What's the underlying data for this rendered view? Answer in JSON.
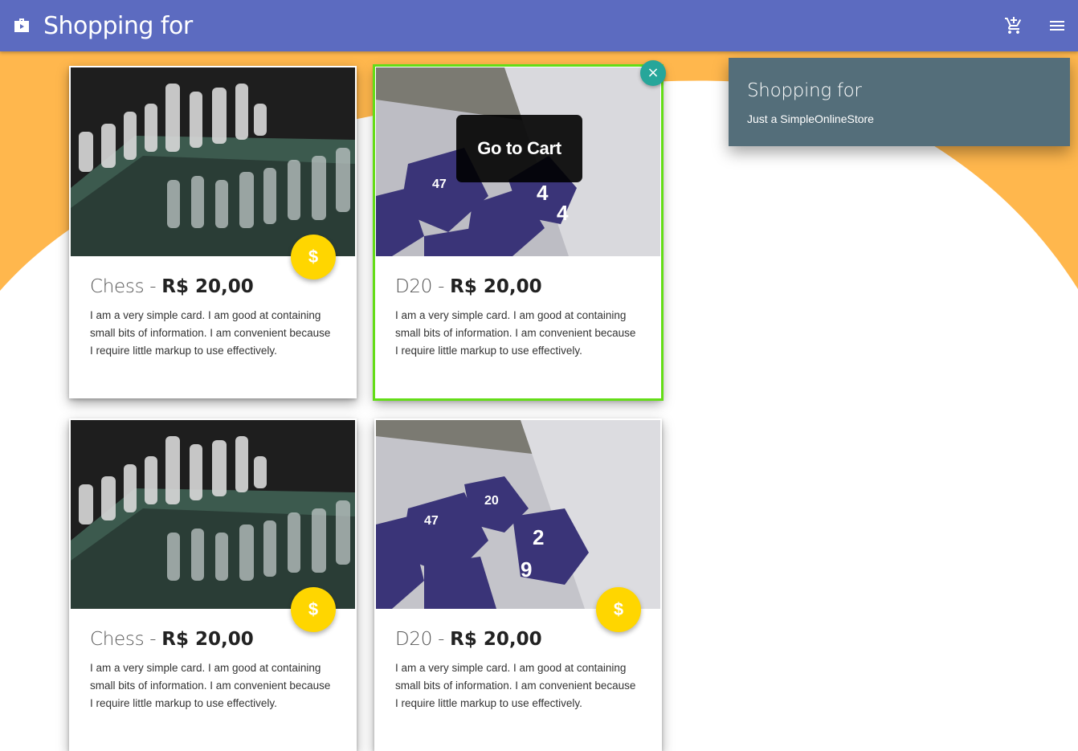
{
  "appbar": {
    "title": "Shopping for",
    "logo_icon": "shopping-bag-play-icon",
    "cart_icon": "add-shopping-cart-icon",
    "menu_icon": "hamburger-menu-icon",
    "color": "#5c6bc0"
  },
  "panel": {
    "title": "Shopping for",
    "subtitle": "Just a SimpleOnlineStore",
    "color": "#546e7a"
  },
  "products": [
    {
      "name": "Chess",
      "separator": " - ",
      "price": "R$ 20,00",
      "description": "I am a very simple card. I am good at containing small bits of information. I am convenient because I require little markup to use effectively.",
      "image": "chess-board-photo",
      "fab_label": "$"
    },
    {
      "name": "D20",
      "separator": " - ",
      "price": "R$ 20,00",
      "description": "I am a very simple card. I am good at containing small bits of information. I am convenient because I require little markup to use effectively.",
      "image": "dice-photo",
      "selected": true,
      "overlay_label": "Go to Cart",
      "close_label": "×"
    },
    {
      "name": "Chess",
      "separator": " - ",
      "price": "R$ 20,00",
      "description": "I am a very simple card. I am good at containing small bits of information. I am convenient because I require little markup to use effectively.",
      "image": "chess-board-photo",
      "fab_label": "$"
    },
    {
      "name": "D20",
      "separator": " - ",
      "price": "R$ 20,00",
      "description": "I am a very simple card. I am good at containing small bits of information. I am convenient because I require little markup to use effectively.",
      "image": "dice-photo",
      "fab_label": "$"
    }
  ],
  "colors": {
    "background_accent": "#ffb74d",
    "fab": "#ffd600",
    "selected_outline": "#64dd17",
    "close_button": "#26a69a"
  }
}
